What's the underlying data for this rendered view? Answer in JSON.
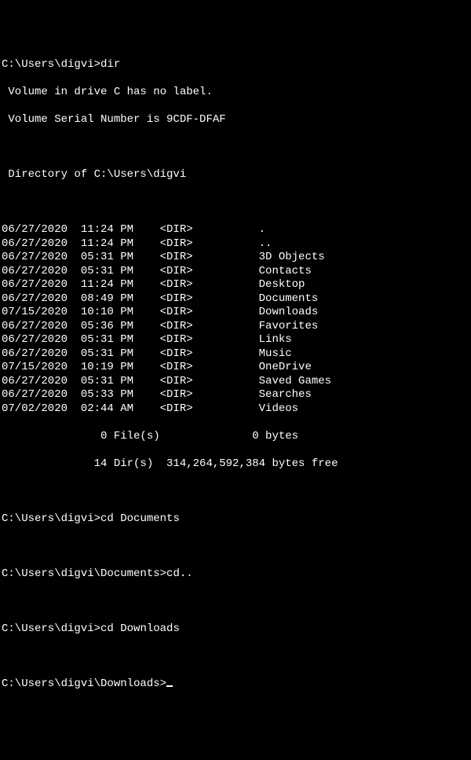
{
  "prompt1": {
    "path": "C:\\Users\\digvi>",
    "cmd": "dir"
  },
  "volume_line1": " Volume in drive C has no label.",
  "volume_line2": " Volume Serial Number is 9CDF-DFAF",
  "dir_of": " Directory of C:\\Users\\digvi",
  "entries": [
    {
      "date": "06/27/2020",
      "time": "11:24 PM",
      "type": "<DIR>",
      "name": "."
    },
    {
      "date": "06/27/2020",
      "time": "11:24 PM",
      "type": "<DIR>",
      "name": ".."
    },
    {
      "date": "06/27/2020",
      "time": "05:31 PM",
      "type": "<DIR>",
      "name": "3D Objects"
    },
    {
      "date": "06/27/2020",
      "time": "05:31 PM",
      "type": "<DIR>",
      "name": "Contacts"
    },
    {
      "date": "06/27/2020",
      "time": "11:24 PM",
      "type": "<DIR>",
      "name": "Desktop"
    },
    {
      "date": "06/27/2020",
      "time": "08:49 PM",
      "type": "<DIR>",
      "name": "Documents"
    },
    {
      "date": "07/15/2020",
      "time": "10:10 PM",
      "type": "<DIR>",
      "name": "Downloads"
    },
    {
      "date": "06/27/2020",
      "time": "05:36 PM",
      "type": "<DIR>",
      "name": "Favorites"
    },
    {
      "date": "06/27/2020",
      "time": "05:31 PM",
      "type": "<DIR>",
      "name": "Links"
    },
    {
      "date": "06/27/2020",
      "time": "05:31 PM",
      "type": "<DIR>",
      "name": "Music"
    },
    {
      "date": "07/15/2020",
      "time": "10:19 PM",
      "type": "<DIR>",
      "name": "OneDrive"
    },
    {
      "date": "06/27/2020",
      "time": "05:31 PM",
      "type": "<DIR>",
      "name": "Saved Games"
    },
    {
      "date": "06/27/2020",
      "time": "05:33 PM",
      "type": "<DIR>",
      "name": "Searches"
    },
    {
      "date": "07/02/2020",
      "time": "02:44 AM",
      "type": "<DIR>",
      "name": "Videos"
    }
  ],
  "summary_files": "               0 File(s)              0 bytes",
  "summary_dirs": "              14 Dir(s)  314,264,592,384 bytes free",
  "prompt2": {
    "path": "C:\\Users\\digvi>",
    "cmd": "cd Documents"
  },
  "prompt3": {
    "path": "C:\\Users\\digvi\\Documents>",
    "cmd": "cd.."
  },
  "prompt4": {
    "path": "C:\\Users\\digvi>",
    "cmd": "cd Downloads"
  },
  "prompt5": {
    "path": "C:\\Users\\digvi\\Downloads>",
    "cmd": ""
  }
}
